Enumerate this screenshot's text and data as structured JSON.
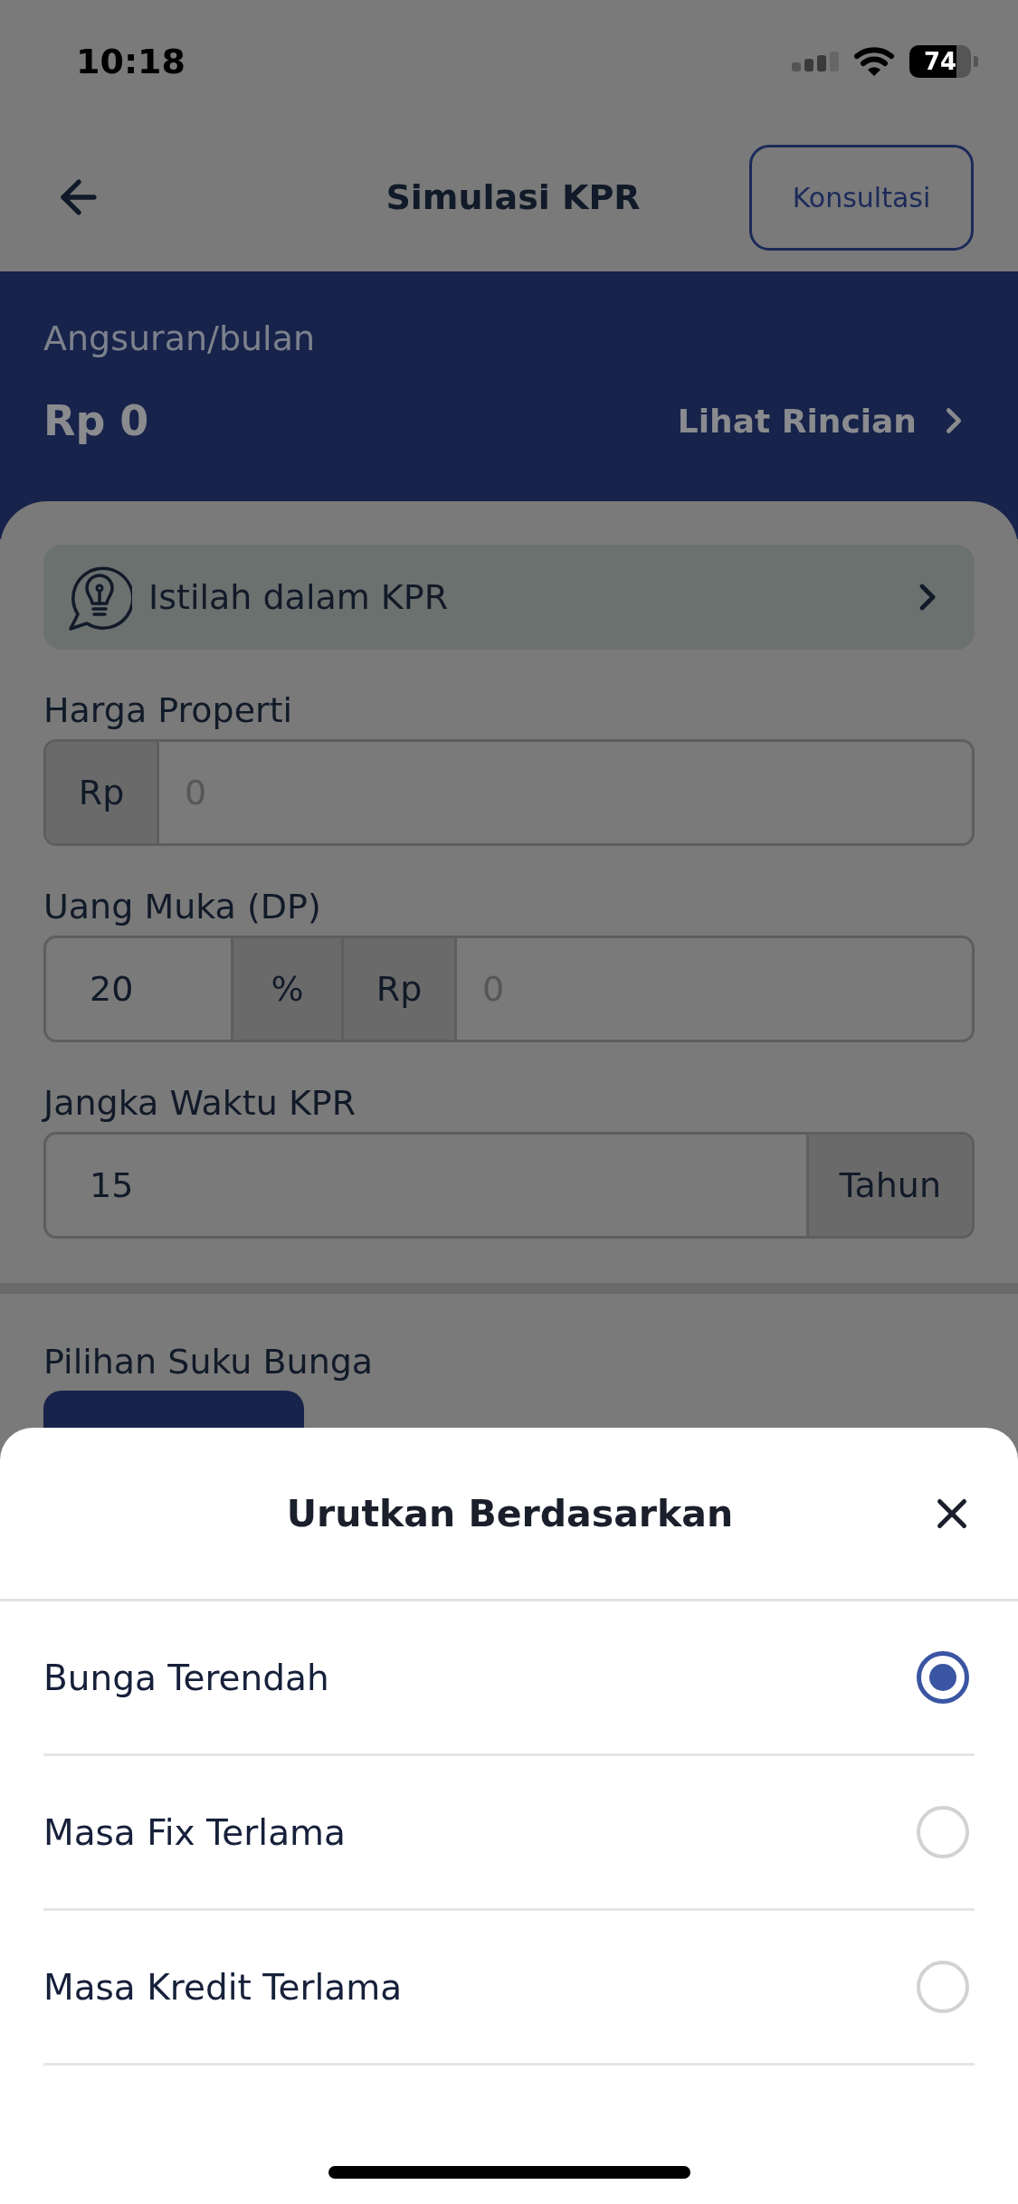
{
  "status_bar": {
    "time": "10:18",
    "battery": "74"
  },
  "nav_bar": {
    "title": "Simulasi KPR",
    "action_button": "Konsultasi"
  },
  "summary": {
    "label": "Angsuran/bulan",
    "amount": "Rp 0",
    "link": "Lihat Rincian"
  },
  "glossary_banner": {
    "label": "Istilah dalam KPR"
  },
  "form": {
    "fields": [
      {
        "label": "Harga Properti",
        "segments": [
          {
            "kind": "addon",
            "text": "Rp"
          },
          {
            "kind": "input",
            "placeholder": "0"
          }
        ]
      },
      {
        "label": "Uang Muka (DP)",
        "segments": [
          {
            "kind": "input",
            "value": "20"
          },
          {
            "kind": "addon",
            "text": "%"
          },
          {
            "kind": "addon",
            "text": "Rp"
          },
          {
            "kind": "input",
            "placeholder": "0"
          }
        ]
      },
      {
        "label": "Jangka Waktu KPR",
        "segments": [
          {
            "kind": "input",
            "value": "15"
          },
          {
            "kind": "addon",
            "text": "Tahun"
          }
        ]
      }
    ]
  },
  "interest_options": {
    "label": "Pilihan Suku Bunga"
  },
  "sort_sheet": {
    "title": "Urutkan Berdasarkan",
    "options": [
      {
        "label": "Bunga Terendah",
        "selected": true
      },
      {
        "label": "Masa Fix Terlama",
        "selected": false
      },
      {
        "label": "Masa Kredit Terlama",
        "selected": false
      }
    ]
  }
}
